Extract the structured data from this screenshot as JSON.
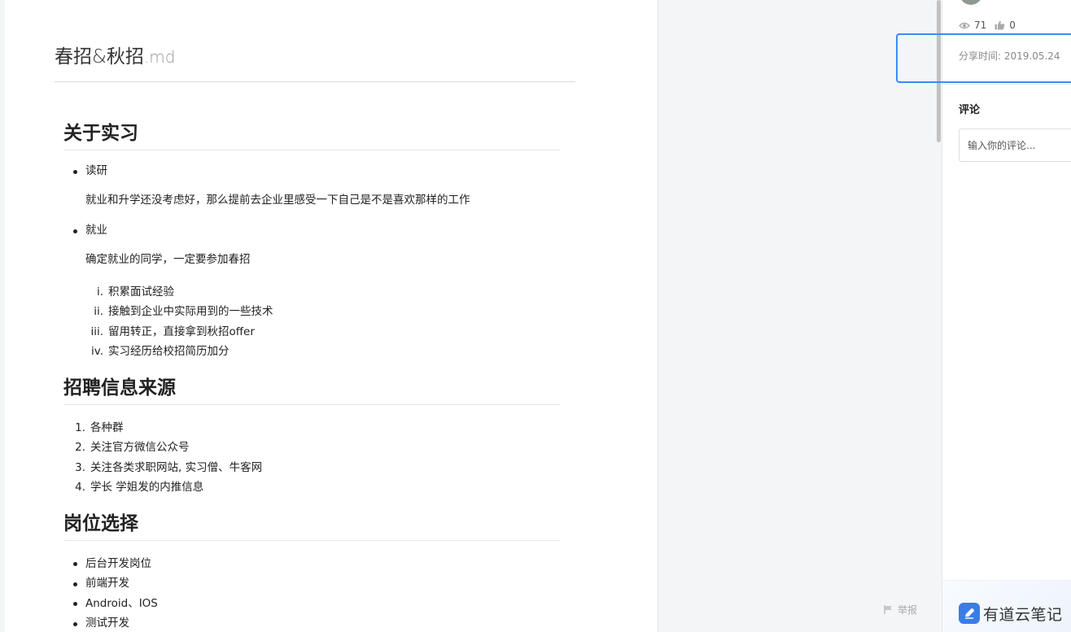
{
  "document": {
    "title_name": "春招&秋招",
    "title_ext": ".md",
    "sections": {
      "internship": {
        "heading": "关于实习",
        "item1_label": "读研",
        "item1_desc": "就业和升学还没考虑好，那么提前去企业里感受一下自己是不是喜欢那样的工作",
        "item2_label": "就业",
        "item2_desc": "确定就业的同学，一定要参加春招",
        "sub_items": [
          {
            "num": "i.",
            "text": "积累面试经验"
          },
          {
            "num": "ii.",
            "text": "接触到企业中实际用到的一些技术"
          },
          {
            "num": "iii.",
            "text": "留用转正，直接拿到秋招offer"
          },
          {
            "num": "iv.",
            "text": "实习经历给校招简历加分"
          }
        ]
      },
      "sources": {
        "heading": "招聘信息来源",
        "items": [
          {
            "num": "1.",
            "text": "各种群"
          },
          {
            "num": "2.",
            "text": "关注官方微信公众号"
          },
          {
            "num": "3.",
            "text": "关注各类求职网站, 实习僧、牛客网"
          },
          {
            "num": "4.",
            "text": "学长 学姐发的内推信息"
          }
        ]
      },
      "positions": {
        "heading": "岗位选择",
        "items": [
          "后台开发岗位",
          "前端开发",
          "Android、IOS",
          "测试开发"
        ]
      }
    }
  },
  "sidebar": {
    "views_icon": "eye-icon",
    "views": "71",
    "likes_icon": "thumbs-up-icon",
    "likes": "0",
    "share_time": "分享时间: 2019.05.24",
    "comments_title": "评论",
    "comment_placeholder": "输入你的评论..."
  },
  "footer": {
    "report_icon": "flag-icon",
    "report_label": "举报",
    "brand_icon": "youdao-note-logo-icon",
    "brand_name": "有道云笔记"
  },
  "colors": {
    "accent": "#3b8cf0",
    "brand": "#3a7de8"
  }
}
